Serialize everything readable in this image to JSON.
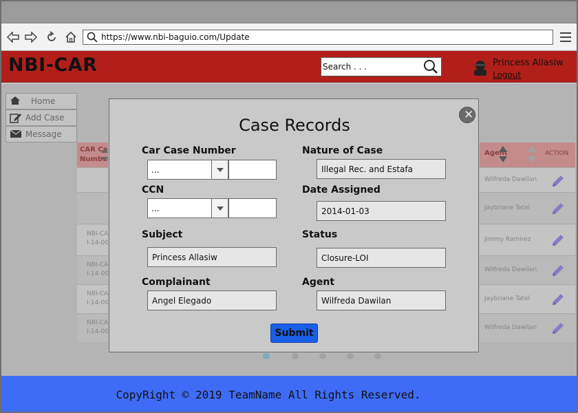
{
  "browser": {
    "url": "https://www.nbi-baguio.com/Update"
  },
  "header": {
    "brand": "NBI-CAR",
    "search_placeholder": "Search . . .",
    "user_name": "Princess Allasiw",
    "logout_label": "Logout"
  },
  "sidebar": {
    "items": [
      {
        "label": "Home",
        "icon": "home-icon"
      },
      {
        "label": "Add Case",
        "icon": "edit-icon"
      },
      {
        "label": "Message",
        "icon": "envelope-icon"
      }
    ]
  },
  "table": {
    "headers": {
      "car_case_line1": "CAR Case",
      "car_case_line2": "Number",
      "agent": "Agent",
      "action": "ACTION"
    },
    "rows": [
      {
        "case_line1": "",
        "case_line2": "",
        "agent": "Wilfreda Dawilan"
      },
      {
        "case_line1": "",
        "case_line2": "",
        "agent": "Jaybriane Tatel"
      },
      {
        "case_line1": "NBI-CA",
        "case_line2": "I-14-00",
        "agent": "Jimmy Ramirez"
      },
      {
        "case_line1": "NBI-CA",
        "case_line2": "I-14-00",
        "agent": "Wilfreda Dawilan"
      },
      {
        "case_line1": "NBI-CA",
        "case_line2": "I-14-00",
        "agent": "Jaybriane Tatel"
      },
      {
        "case_line1": "NBI-CA",
        "case_line2": "I-14-00",
        "agent": "Wilfreda Dawilan"
      }
    ]
  },
  "modal": {
    "title": "Case Records",
    "close_glyph": "✕",
    "fields": {
      "car_case_number": {
        "label": "Car Case Number",
        "select_value": "...",
        "text_value": ""
      },
      "ccn": {
        "label": "CCN",
        "select_value": "...",
        "text_value": ""
      },
      "subject": {
        "label": "Subject",
        "value": "Princess Allasiw"
      },
      "complainant": {
        "label": "Complainant",
        "value": "Angel Elegado"
      },
      "nature_of_case": {
        "label": "Nature of Case",
        "value": "Illegal Rec. and Estafa"
      },
      "date_assigned": {
        "label": "Date Assigned",
        "value": "2014-01-03"
      },
      "status": {
        "label": "Status",
        "value": "Closure-LOI"
      },
      "agent": {
        "label": "Agent",
        "value": "Wilfreda Dawilan"
      }
    },
    "submit_label": "Submit"
  },
  "footer": {
    "text": "CopyRight © 2019 TeamName All Rights Reserved."
  },
  "colors": {
    "header_red": "#b21f1b",
    "footer_blue": "#3f6cf7",
    "submit_blue": "#1a5fe8",
    "edit_icon": "#9b8fe0"
  }
}
